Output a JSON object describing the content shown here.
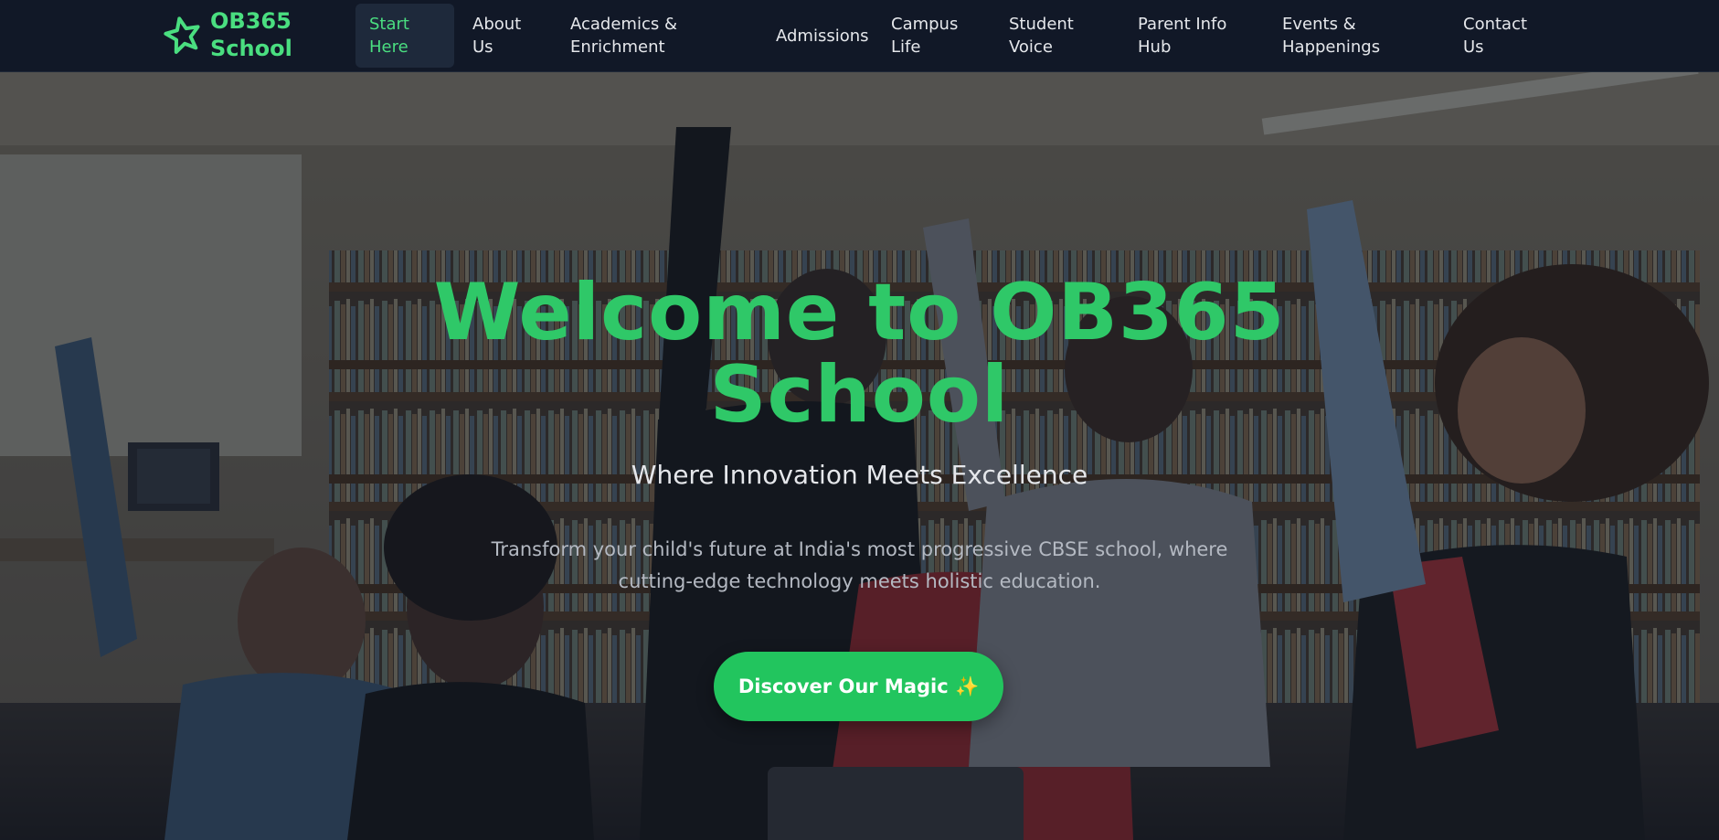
{
  "colors": {
    "accent": "#4ade80",
    "title_green": "#2fc868",
    "button_green": "#22c55e",
    "nav_bg": "#111827"
  },
  "brand": {
    "icon": "star-outline-icon",
    "name_line1": "OB365",
    "name_line2": "School"
  },
  "nav": {
    "items": [
      {
        "line1": "Start",
        "line2": "Here",
        "active": true
      },
      {
        "line1": "About",
        "line2": "Us"
      },
      {
        "line1": "Academics &",
        "line2": "Enrichment"
      },
      {
        "line1": "Admissions",
        "line2": ""
      },
      {
        "line1": "Campus",
        "line2": "Life"
      },
      {
        "line1": "Student",
        "line2": "Voice"
      },
      {
        "line1": "Parent Info",
        "line2": "Hub"
      },
      {
        "line1": "Events &",
        "line2": "Happenings"
      },
      {
        "line1": "Contact",
        "line2": "Us"
      }
    ]
  },
  "hero": {
    "title_line1": "Welcome to OB365",
    "title_line2": "School",
    "subtitle": "Where Innovation Meets Excellence",
    "description": "Transform your child's future at India's most progressive CBSE school, where cutting-edge technology meets holistic education.",
    "cta_label": "Discover Our Magic ✨",
    "background_image": "students-cheering-in-library-photo"
  }
}
